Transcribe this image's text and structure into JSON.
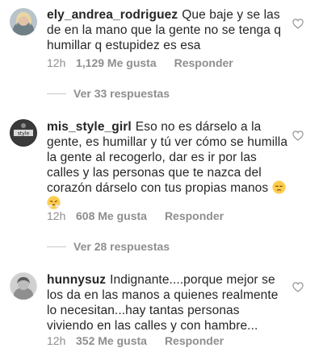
{
  "comments": [
    {
      "username": "ely_andrea_rodriguez",
      "text": "Que baje y se las de en la mano que la gente no se tenga q humillar q estupidez es esa",
      "time": "12h",
      "likes": "1,129 Me gusta",
      "reply_label": "Responder"
    },
    {
      "username": "mis_style_girl",
      "text": "Eso no es dárselo a la gente, es humillar y tú ver cómo se humilla la gente al recogerlo, dar es ir por las calles y las personas que te nazca del corazón dárselo con tus propias manos",
      "time": "12h",
      "likes": "608 Me gusta",
      "reply_label": "Responder"
    },
    {
      "username": "hunnysuz",
      "text": "Indignante....porque mejor se los da en las manos a quienes realmente lo necesitan...hay tantas personas viviendo en las calles y con hambre...",
      "time": "12h",
      "likes": "352 Me gusta",
      "reply_label": "Responder"
    }
  ],
  "view_replies": [
    "Ver 33 respuestas",
    "Ver 28 respuestas"
  ],
  "colors": {
    "text": "#262626",
    "secondary": "#8e8e8e",
    "divider": "#c7c7c7"
  },
  "icons": {
    "like": "heart-outline-icon",
    "emoji_1": "pensive-face-emoji",
    "emoji_2": "face-with-steam-emoji"
  }
}
